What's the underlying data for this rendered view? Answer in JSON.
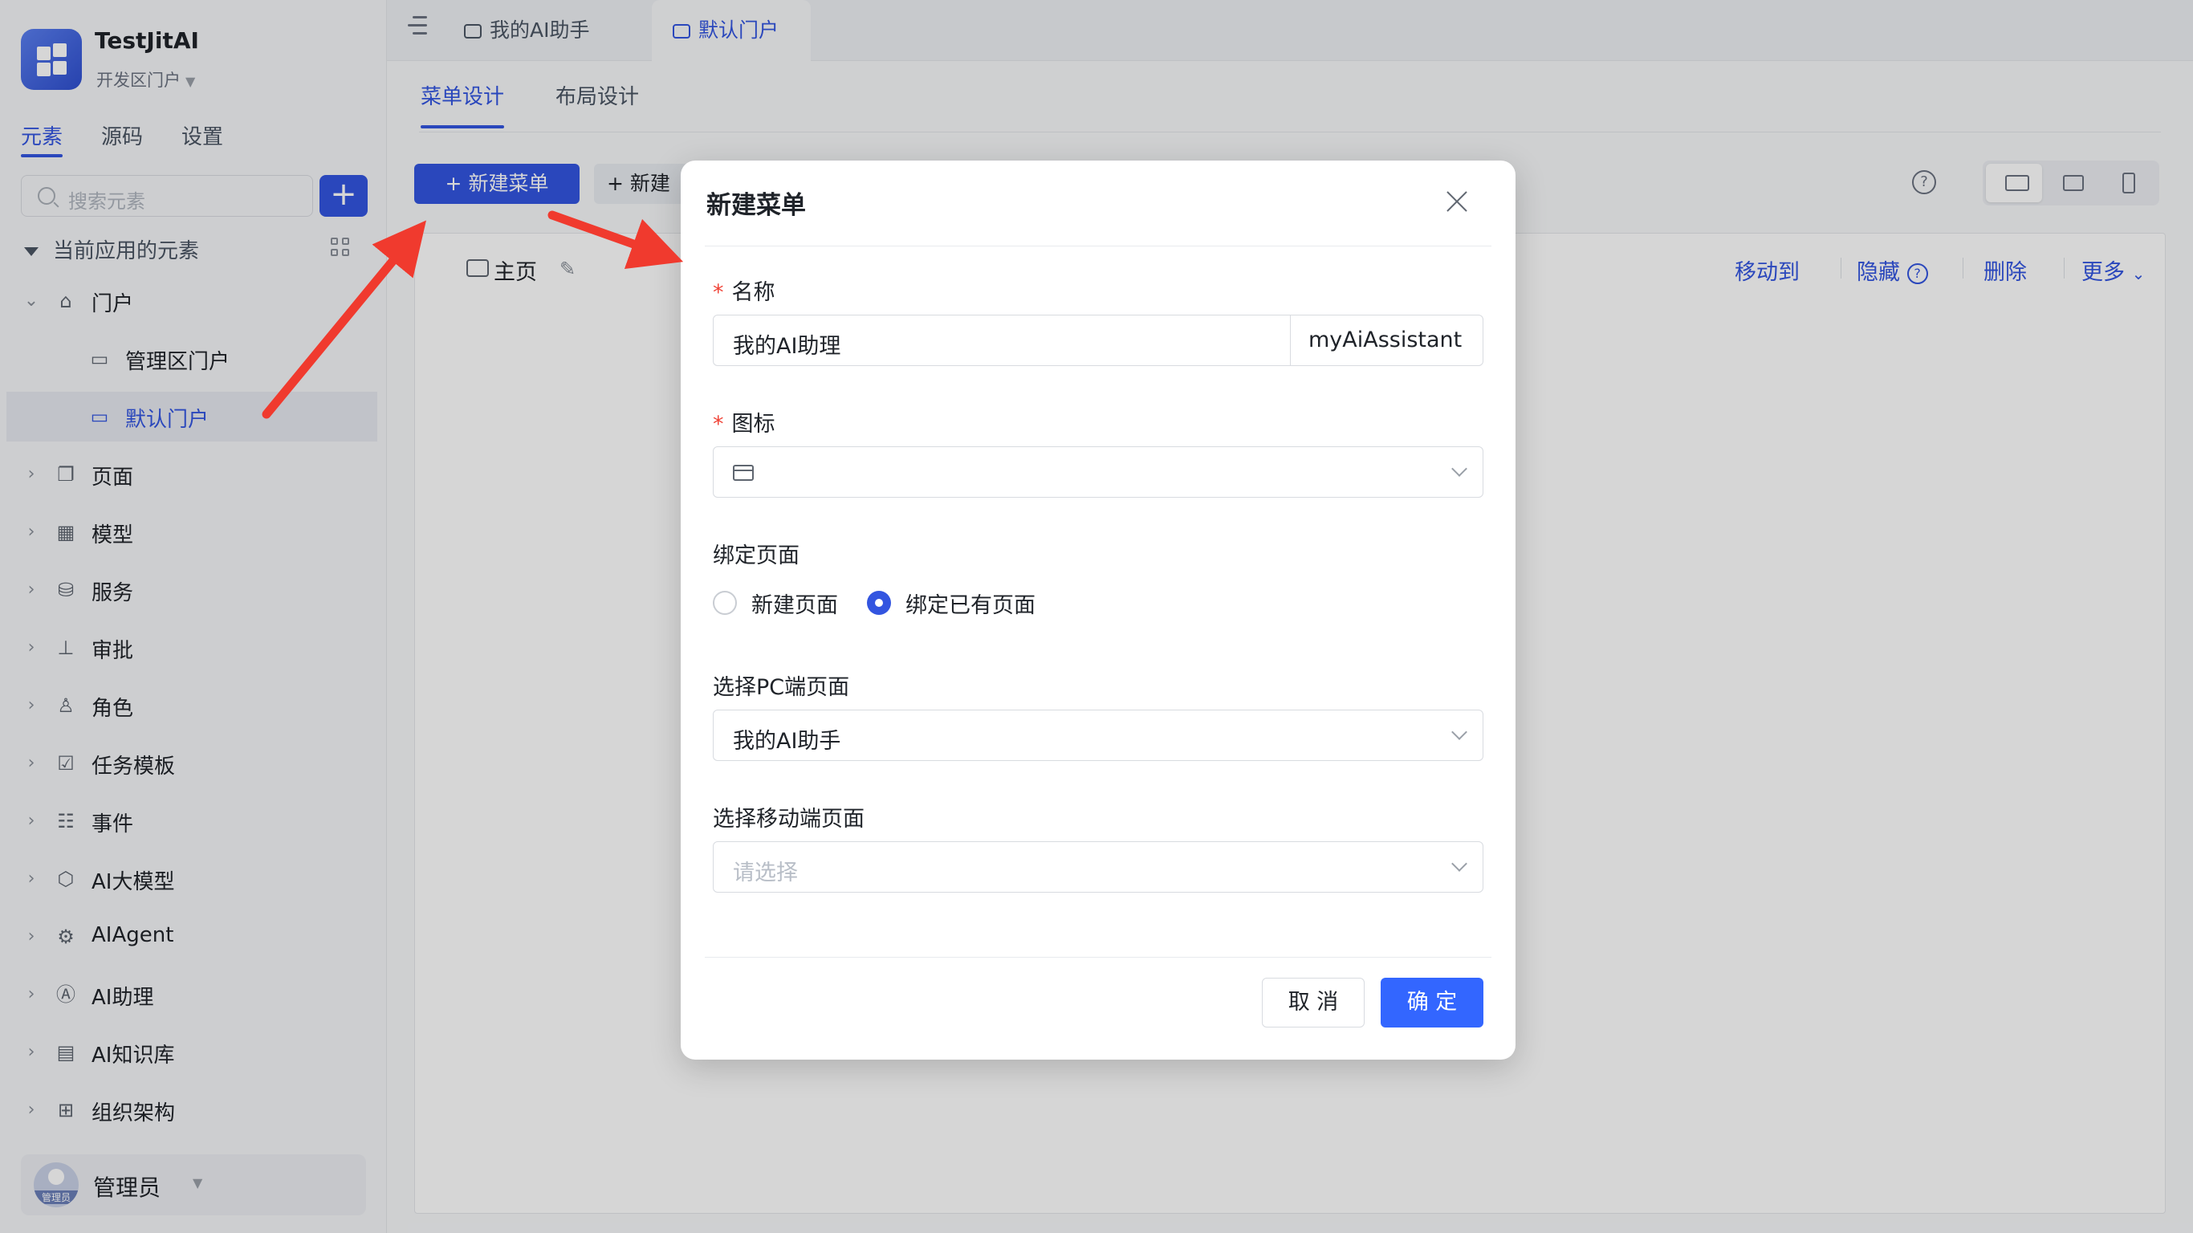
{
  "app": {
    "name": "TestJitAI",
    "portal": "开发区门户"
  },
  "sidebar": {
    "tabs": [
      "元素",
      "源码",
      "设置"
    ],
    "search_placeholder": "搜索元素",
    "add_label": "+",
    "section_title": "当前应用的元素",
    "tree": [
      {
        "label": "门户",
        "icon": "home-icon",
        "expanded": true
      },
      {
        "label": "管理区门户",
        "icon": "portal-icon"
      },
      {
        "label": "默认门户",
        "icon": "portal-icon",
        "selected": true
      },
      {
        "label": "页面",
        "icon": "page-icon"
      },
      {
        "label": "模型",
        "icon": "table-icon"
      },
      {
        "label": "服务",
        "icon": "service-icon"
      },
      {
        "label": "审批",
        "icon": "stamp-icon"
      },
      {
        "label": "角色",
        "icon": "role-icon"
      },
      {
        "label": "任务模板",
        "icon": "task-icon"
      },
      {
        "label": "事件",
        "icon": "event-icon"
      },
      {
        "label": "AI大模型",
        "icon": "cube-icon"
      },
      {
        "label": "AIAgent",
        "icon": "robot-icon"
      },
      {
        "label": "AI助理",
        "icon": "ai-icon"
      },
      {
        "label": "AI知识库",
        "icon": "book-icon"
      },
      {
        "label": "组织架构",
        "icon": "org-icon"
      }
    ],
    "user": {
      "name": "管理员",
      "avatar_label": "管理员"
    }
  },
  "topbar": {
    "tabs": [
      {
        "label": "我的AI助手",
        "active": false
      },
      {
        "label": "默认门户",
        "active": true
      }
    ]
  },
  "main": {
    "sub_tabs": [
      "菜单设计",
      "布局设计"
    ],
    "new_menu_label": "+ 新建菜单",
    "new_secondary_label": "+ 新建",
    "help_label": "?",
    "home_label": "主页",
    "actions": [
      "移动到",
      "隐藏",
      "删除",
      "更多"
    ]
  },
  "modal": {
    "title": "新建菜单",
    "name_label": "名称",
    "name_value": "我的AI助理",
    "name_suffix": "myAiAssistant",
    "icon_label": "图标",
    "bind_label": "绑定页面",
    "radio_new": "新建页面",
    "radio_existing": "绑定已有页面",
    "pc_label": "选择PC端页面",
    "pc_value": "我的AI助手",
    "mobile_label": "选择移动端页面",
    "mobile_placeholder": "请选择",
    "cancel": "取 消",
    "ok": "确 定"
  },
  "colors": {
    "primary": "#3355e0",
    "confirm": "#3366ff",
    "required": "#f04438",
    "annotation_arrow": "#f03a2e"
  }
}
